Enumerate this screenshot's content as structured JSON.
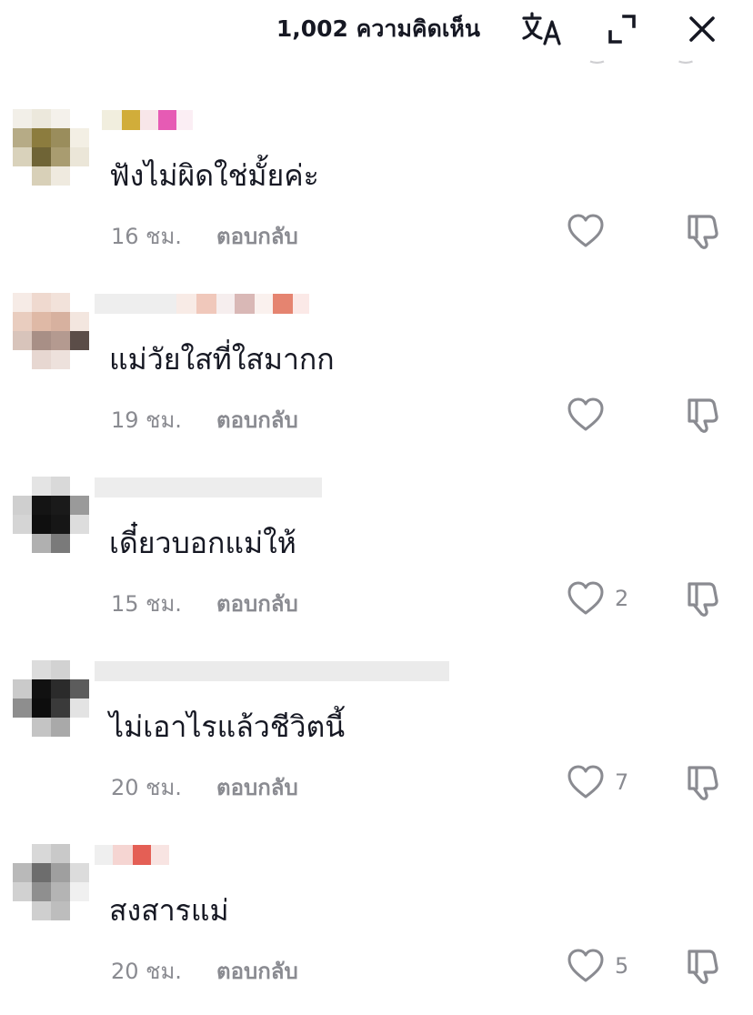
{
  "header": {
    "comment_count_label": "1,002 ความคิดเห็น",
    "icons": [
      "translate-icon",
      "collapse-icon",
      "close-icon"
    ]
  },
  "colors": {
    "text": "#161823",
    "secondary": "#8a8b91",
    "icon": "#161823"
  },
  "comments": [
    {
      "text": "ฟังไม่ผิดใช่มั้ยค่ะ",
      "time": "16 ชม.",
      "reply_label": "ตอบกลับ",
      "likes": ""
    },
    {
      "text": "แม่วัยใสที่ใสมากก",
      "time": "19 ชม.",
      "reply_label": "ตอบกลับ",
      "likes": ""
    },
    {
      "text": "เดี๋ยวบอกแม่ให้",
      "time": "15 ชม.",
      "reply_label": "ตอบกลับ",
      "likes": "2"
    },
    {
      "text": "ไม่เอาไรแล้วชีวิตนี้",
      "time": "20 ชม.",
      "reply_label": "ตอบกลับ",
      "likes": "7"
    },
    {
      "text": "สงสารแม่",
      "time": "20 ชม.",
      "reply_label": "ตอบกลับ",
      "likes": "5"
    }
  ]
}
